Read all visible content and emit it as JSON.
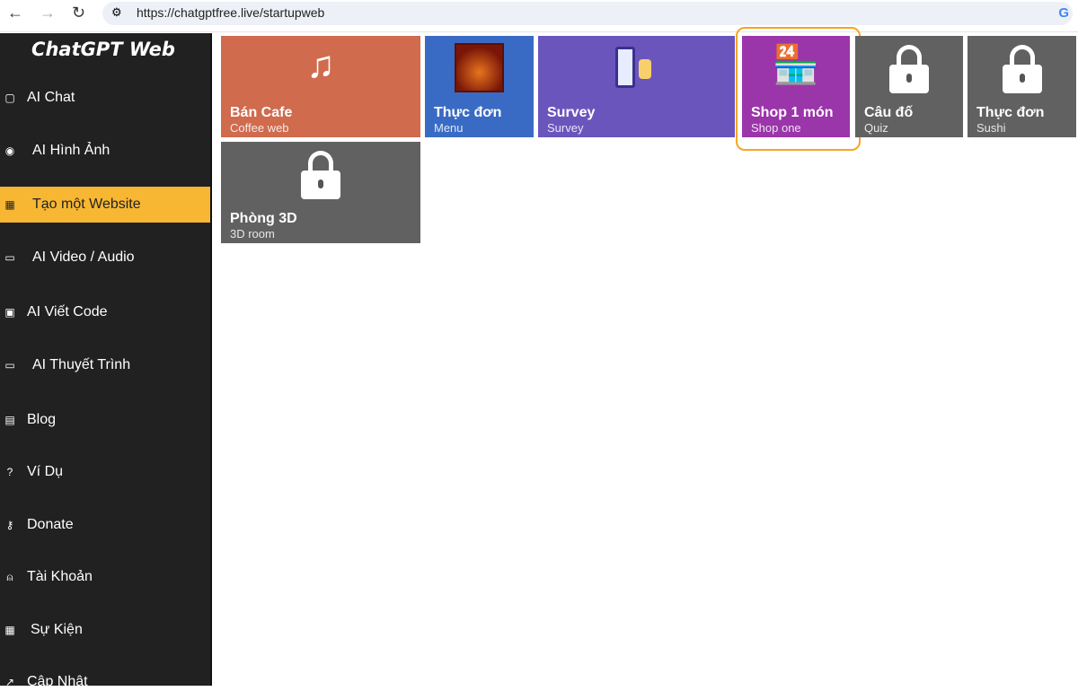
{
  "browser": {
    "url": "https://chatgptfree.live/startupweb"
  },
  "sidebar": {
    "title": "ChatGPT Web",
    "items": [
      {
        "label": "AI Chat",
        "icon": "chat-icon"
      },
      {
        "label": "AI Hình Ảnh",
        "icon": "discord-icon"
      },
      {
        "label": "Tạo một Website",
        "icon": "website-icon",
        "active": true
      },
      {
        "label": "AI Video / Audio",
        "icon": "video-icon"
      },
      {
        "label": "AI Viết Code",
        "icon": "code-icon"
      },
      {
        "label": "AI Thuyết Trình",
        "icon": "video-icon"
      },
      {
        "label": "Blog",
        "icon": "blog-icon"
      },
      {
        "label": "Ví Dụ",
        "icon": "help-icon"
      },
      {
        "label": "Donate",
        "icon": "key-icon"
      },
      {
        "label": "Tài Khoản",
        "icon": "user-icon"
      },
      {
        "label": "Sự Kiện",
        "icon": "calendar-icon"
      },
      {
        "label": "Cập Nhật",
        "icon": "external-link-icon"
      }
    ]
  },
  "tiles": [
    {
      "title": "Bán Cafe",
      "subtitle": "Coffee web",
      "color": "#d06b4e",
      "icon": "music-note-icon"
    },
    {
      "title": "Thực đơn",
      "subtitle": "Menu",
      "color": "#3a6bc4",
      "icon": "menu-image-icon"
    },
    {
      "title": "Survey",
      "subtitle": "Survey",
      "color": "#6a55bd",
      "icon": "survey-illustration-icon"
    },
    {
      "title": "Shop 1 món",
      "subtitle": "Shop one",
      "color": "#9b35aa",
      "icon": "shop-icon"
    },
    {
      "title": "Câu đố",
      "subtitle": "Quiz",
      "color": "#616161",
      "icon": "lock-icon"
    },
    {
      "title": "Thực đơn",
      "subtitle": "Sushi",
      "color": "#616161",
      "icon": "lock-icon"
    },
    {
      "title": "Phòng 3D",
      "subtitle": "3D room",
      "color": "#616161",
      "icon": "lock-icon"
    }
  ]
}
